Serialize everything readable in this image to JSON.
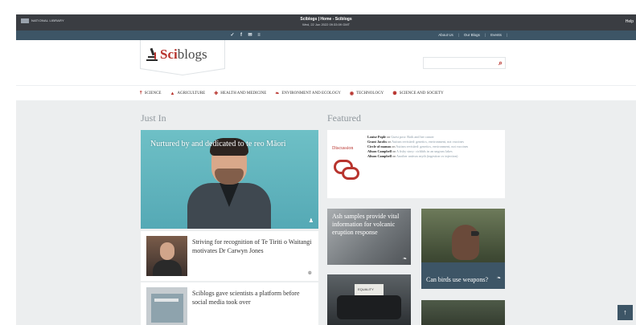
{
  "archive": {
    "logo_text": "NATIONAL LIBRARY",
    "title": "Sciblogs | Home - Sciblogs",
    "date": "Wed, 22 Jun 2022 09:33:09 GMT",
    "help": "Help"
  },
  "social": [
    "✓",
    "f",
    "✉",
    "≡"
  ],
  "topnav": {
    "about": "About Us",
    "blogs": "Our Blogs",
    "events": "Events",
    "sep": "|"
  },
  "logo": {
    "sci": "Sci",
    "blogs": "blogs"
  },
  "search": {
    "placeholder": "",
    "icon": "search-icon"
  },
  "categories": [
    {
      "label": "SCIENCE",
      "icon": "microscope-icon"
    },
    {
      "label": "AGRICULTURE",
      "icon": "tractor-icon"
    },
    {
      "label": "HEALTH AND MEDICINE",
      "icon": "cross-icon"
    },
    {
      "label": "ENVIRONMENT AND ECOLOGY",
      "icon": "leaf-icon"
    },
    {
      "label": "TECHNOLOGY",
      "icon": "chip-icon"
    },
    {
      "label": "SCIENCE AND SOCIETY",
      "icon": "people-icon"
    }
  ],
  "just_in": {
    "heading": "Just In",
    "hero_title": "Nurtured by and dedicated to te reo Māori",
    "cards": [
      {
        "title": "Striving for recognition of Te Tiriti o Waitangi motivates Dr Carwyn Jones"
      },
      {
        "title": "Sciblogs gave scientists a platform before social media took over"
      }
    ]
  },
  "featured": {
    "heading": "Featured",
    "discussion_label": "Discussion",
    "comments": [
      {
        "author": "Louise Pople",
        "on": "on",
        "post": "Guest post: Roth and her cancer"
      },
      {
        "author": "Grant Jacobs",
        "on": "on",
        "post": "Autism revisited: genetics, environment, not vaccines"
      },
      {
        "author": "Circle of mamas",
        "on": "on",
        "post": "Autism revisited: genetics, environment, not vaccines"
      },
      {
        "author": "Alison Campbell",
        "on": "on",
        "post": "A fishy story: cichlids in an ungrass lakes"
      },
      {
        "author": "Alison Campbell",
        "on": "on",
        "post": "Another antivax myth (ingestion vs injection)"
      }
    ],
    "tiles": [
      {
        "title": "Ash samples provide vital information for volcanic eruption response"
      },
      {
        "title": "Can birds use weapons?"
      },
      {
        "paper_text": "EQUALITY"
      }
    ]
  },
  "to_top": "↑"
}
